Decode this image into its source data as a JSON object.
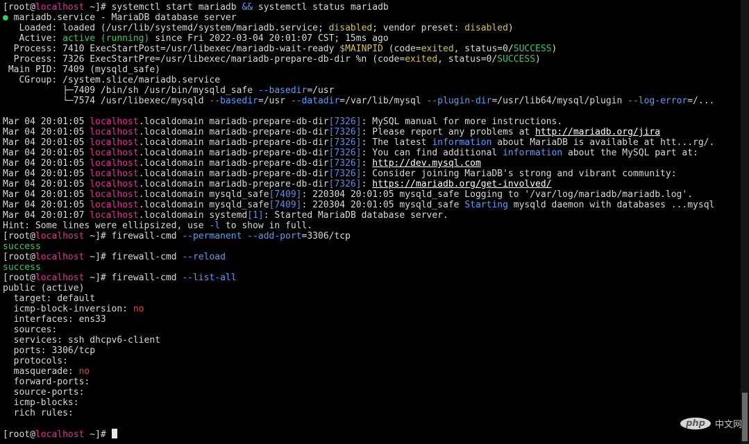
{
  "colors": {
    "default": "#d8d8d8",
    "host": "#e62e9a",
    "green": "#33cc66",
    "yellow": "#d6c63a",
    "cyan": "#4ea1ff",
    "blue": "#5e8ee0",
    "red": "#ef3b3b",
    "white": "#ffffff"
  },
  "terminal": {
    "lines": [
      [
        [
          "[root@",
          "default"
        ],
        [
          "localhost",
          "host"
        ],
        [
          " ~]# systemctl start mariadb ",
          "default"
        ],
        [
          "&&",
          "cyan"
        ],
        [
          " systemctl status mariadb",
          "default"
        ]
      ],
      [
        [
          "●",
          "green"
        ],
        [
          " mariadb.service - MariaDB database server",
          "default"
        ]
      ],
      [
        [
          "   Loaded: loaded (/usr/lib/systemd/system/mariadb.service; ",
          "default"
        ],
        [
          "disabled",
          "yellow"
        ],
        [
          "; vendor preset: ",
          "default"
        ],
        [
          "disabled",
          "yellow"
        ],
        [
          ")",
          "default"
        ]
      ],
      [
        [
          "   Active: ",
          "default"
        ],
        [
          "active (running)",
          "green"
        ],
        [
          " since Fri 2022-03-04 20:01:07 CST; 15ms ago",
          "default"
        ]
      ],
      [
        [
          "  Process: 7410 ExecStartPost=/usr/libexec/mariadb-wait-ready ",
          "default"
        ],
        [
          "$MAINPID",
          "yellow"
        ],
        [
          " (code=",
          "default"
        ],
        [
          "exited",
          "yellow"
        ],
        [
          ", status=0/",
          "default"
        ],
        [
          "SUCCESS",
          "green"
        ],
        [
          ")",
          "default"
        ]
      ],
      [
        [
          "  Process: 7326 ExecStartPre=/usr/libexec/mariadb-prepare-db-dir %n (code=",
          "default"
        ],
        [
          "exited",
          "yellow"
        ],
        [
          ", status=0/",
          "default"
        ],
        [
          "SUCCESS",
          "green"
        ],
        [
          ")",
          "default"
        ]
      ],
      [
        [
          " Main PID: 7409 (mysqld_safe)",
          "default"
        ]
      ],
      [
        [
          "   CGroup: /system.slice/mariadb.service",
          "default"
        ]
      ],
      [
        [
          "           ├─7409 /bin/sh /usr/bin/mysqld_safe ",
          "default"
        ],
        [
          "--basedir",
          "cyan"
        ],
        [
          "=/usr",
          "default"
        ]
      ],
      [
        [
          "           └─7574 /usr/libexec/mysqld ",
          "default"
        ],
        [
          "--basedir",
          "cyan"
        ],
        [
          "=/usr ",
          "default"
        ],
        [
          "--datadir",
          "cyan"
        ],
        [
          "=/var/lib/mysql ",
          "default"
        ],
        [
          "--plugin-dir",
          "cyan"
        ],
        [
          "=/usr/lib64/mysql/plugin ",
          "default"
        ],
        [
          "--log-error",
          "cyan"
        ],
        [
          "=/...",
          "default"
        ]
      ],
      [],
      [
        [
          "Mar 04 20:01:05 ",
          "default"
        ],
        [
          "localhost",
          "host"
        ],
        [
          ".localdomain mariadb-prepare-db-dir",
          "default"
        ],
        [
          "[7326]",
          "blue"
        ],
        [
          ": MySQL manual for more instructions.",
          "default"
        ]
      ],
      [
        [
          "Mar 04 20:01:05 ",
          "default"
        ],
        [
          "localhost",
          "host"
        ],
        [
          ".localdomain mariadb-prepare-db-dir",
          "default"
        ],
        [
          "[7326]",
          "blue"
        ],
        [
          ": Please report any problems at ",
          "default"
        ],
        [
          "http://mariadb.org/jira",
          "link"
        ]
      ],
      [
        [
          "Mar 04 20:01:05 ",
          "default"
        ],
        [
          "localhost",
          "host"
        ],
        [
          ".localdomain mariadb-prepare-db-dir",
          "default"
        ],
        [
          "[7326]",
          "blue"
        ],
        [
          ": The latest ",
          "default"
        ],
        [
          "information",
          "cyan"
        ],
        [
          " about MariaDB is available at htt...rg/.",
          "default"
        ]
      ],
      [
        [
          "Mar 04 20:01:05 ",
          "default"
        ],
        [
          "localhost",
          "host"
        ],
        [
          ".localdomain mariadb-prepare-db-dir",
          "default"
        ],
        [
          "[7326]",
          "blue"
        ],
        [
          ": You can find additional ",
          "default"
        ],
        [
          "information",
          "cyan"
        ],
        [
          " about the MySQL part at:",
          "default"
        ]
      ],
      [
        [
          "Mar 04 20:01:05 ",
          "default"
        ],
        [
          "localhost",
          "host"
        ],
        [
          ".localdomain mariadb-prepare-db-dir",
          "default"
        ],
        [
          "[7326]",
          "blue"
        ],
        [
          ": ",
          "default"
        ],
        [
          "http://dev.mysql.com",
          "link"
        ]
      ],
      [
        [
          "Mar 04 20:01:05 ",
          "default"
        ],
        [
          "localhost",
          "host"
        ],
        [
          ".localdomain mariadb-prepare-db-dir",
          "default"
        ],
        [
          "[7326]",
          "blue"
        ],
        [
          ": Consider joining MariaDB's strong and vibrant community:",
          "default"
        ]
      ],
      [
        [
          "Mar 04 20:01:05 ",
          "default"
        ],
        [
          "localhost",
          "host"
        ],
        [
          ".localdomain mariadb-prepare-db-dir",
          "default"
        ],
        [
          "[7326]",
          "blue"
        ],
        [
          ": ",
          "default"
        ],
        [
          "https://mariadb.org/get-involved/",
          "link"
        ]
      ],
      [
        [
          "Mar 04 20:01:05 ",
          "default"
        ],
        [
          "localhost",
          "host"
        ],
        [
          ".localdomain mysqld_safe",
          "default"
        ],
        [
          "[7409]",
          "blue"
        ],
        [
          ": 220304 20:01:05 mysqld_safe Logging to '/var/log/mariadb/mariadb.log'.",
          "default"
        ]
      ],
      [
        [
          "Mar 04 20:01:05 ",
          "default"
        ],
        [
          "localhost",
          "host"
        ],
        [
          ".localdomain mysqld_safe",
          "default"
        ],
        [
          "[7409]",
          "blue"
        ],
        [
          ": 220304 20:01:05 mysqld_safe ",
          "default"
        ],
        [
          "Starting",
          "cyan"
        ],
        [
          " mysqld daemon with databases ...mysql",
          "default"
        ]
      ],
      [
        [
          "Mar 04 20:01:07 ",
          "default"
        ],
        [
          "localhost",
          "host"
        ],
        [
          ".localdomain systemd",
          "default"
        ],
        [
          "[1]",
          "blue"
        ],
        [
          ": Started MariaDB database server.",
          "default"
        ]
      ],
      [
        [
          "Hint: Some lines were ellipsized, use ",
          "default"
        ],
        [
          "-l",
          "cyan"
        ],
        [
          " to show in full.",
          "default"
        ]
      ],
      [
        [
          "[root@",
          "default"
        ],
        [
          "localhost",
          "host"
        ],
        [
          " ~]# firewall-cmd ",
          "default"
        ],
        [
          "--permanent",
          "cyan"
        ],
        [
          " ",
          "default"
        ],
        [
          "--add-port",
          "cyan"
        ],
        [
          "=3306/tcp",
          "default"
        ]
      ],
      [
        [
          "success",
          "green"
        ]
      ],
      [
        [
          "[root@",
          "default"
        ],
        [
          "localhost",
          "host"
        ],
        [
          " ~]# firewall-cmd ",
          "default"
        ],
        [
          "--reload",
          "cyan"
        ]
      ],
      [
        [
          "success",
          "green"
        ]
      ],
      [
        [
          "[root@",
          "default"
        ],
        [
          "localhost",
          "host"
        ],
        [
          " ~]# firewall-cmd ",
          "default"
        ],
        [
          "--list-all",
          "cyan"
        ]
      ],
      [
        [
          "public (active)",
          "default"
        ]
      ],
      [
        [
          "  target: default",
          "default"
        ]
      ],
      [
        [
          "  icmp-block-inversion: ",
          "default"
        ],
        [
          "no",
          "red"
        ]
      ],
      [
        [
          "  interfaces: ens33",
          "default"
        ]
      ],
      [
        [
          "  sources: ",
          "default"
        ]
      ],
      [
        [
          "  services: ssh dhcpv6-client",
          "default"
        ]
      ],
      [
        [
          "  ports: 3306/tcp",
          "default"
        ]
      ],
      [
        [
          "  protocols: ",
          "default"
        ]
      ],
      [
        [
          "  masquerade: ",
          "default"
        ],
        [
          "no",
          "red"
        ]
      ],
      [
        [
          "  forward-ports: ",
          "default"
        ]
      ],
      [
        [
          "  source-ports: ",
          "default"
        ]
      ],
      [
        [
          "  icmp-blocks: ",
          "default"
        ]
      ],
      [
        [
          "  rich rules: ",
          "default"
        ]
      ]
    ],
    "prompt_line": [
      [
        "[root@",
        "default"
      ],
      [
        "localhost",
        "host"
      ],
      [
        " ~]# ",
        "default"
      ]
    ]
  },
  "watermark": {
    "logo": "php",
    "site": "中文网"
  }
}
